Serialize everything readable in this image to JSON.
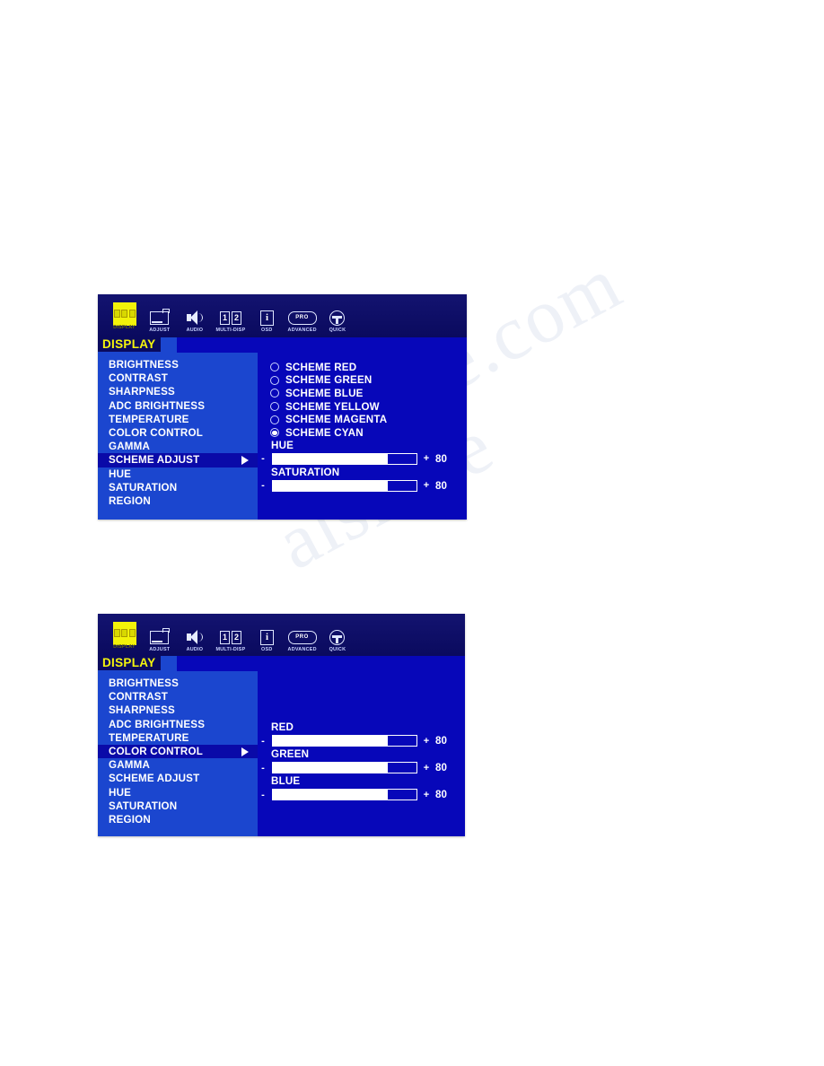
{
  "page": {
    "watermark_lines": [
      "e.com",
      "alsnive"
    ]
  },
  "osd_panels": [
    {
      "id": "scheme-adjust",
      "toolbar": {
        "items": [
          {
            "label": "DISPLAY",
            "icon": "display-icon",
            "active": true
          },
          {
            "label": "ADJUST",
            "icon": "monitor-icon",
            "active": false
          },
          {
            "label": "AUDIO",
            "icon": "speaker-icon",
            "active": false
          },
          {
            "label": "MULTI-DISP",
            "icon": "multi-display-icon",
            "active": false,
            "box1": "1",
            "box2": "2"
          },
          {
            "label": "OSD",
            "icon": "info-icon",
            "active": false,
            "glyph": "i"
          },
          {
            "label": "ADVANCED",
            "icon": "pro-badge-icon",
            "active": false,
            "glyph": "PRO"
          },
          {
            "label": "QUICK",
            "icon": "quick-icon",
            "active": false
          }
        ]
      },
      "active_tab_label": "DISPLAY",
      "menu": [
        {
          "label": "BRIGHTNESS",
          "selected": false
        },
        {
          "label": "CONTRAST",
          "selected": false
        },
        {
          "label": "SHARPNESS",
          "selected": false
        },
        {
          "label": "ADC BRIGHTNESS",
          "selected": false
        },
        {
          "label": "TEMPERATURE",
          "selected": false
        },
        {
          "label": "COLOR CONTROL",
          "selected": false
        },
        {
          "label": "GAMMA",
          "selected": false
        },
        {
          "label": "SCHEME ADJUST",
          "selected": true
        },
        {
          "label": "HUE",
          "selected": false
        },
        {
          "label": "SATURATION",
          "selected": false
        },
        {
          "label": "REGION",
          "selected": false
        }
      ],
      "radio_options": [
        {
          "label": "SCHEME RED",
          "checked": false
        },
        {
          "label": "SCHEME GREEN",
          "checked": false
        },
        {
          "label": "SCHEME BLUE",
          "checked": false
        },
        {
          "label": "SCHEME YELLOW",
          "checked": false
        },
        {
          "label": "SCHEME MAGENTA",
          "checked": false
        },
        {
          "label": "SCHEME CYAN",
          "checked": true
        }
      ],
      "sliders": [
        {
          "label": "HUE",
          "minus": "-",
          "plus": "+",
          "value": "80",
          "percent": 80
        },
        {
          "label": "SATURATION",
          "minus": "-",
          "plus": "+",
          "value": "80",
          "percent": 80
        }
      ]
    },
    {
      "id": "color-control",
      "toolbar": {
        "items": [
          {
            "label": "DISPLAY",
            "icon": "display-icon",
            "active": true
          },
          {
            "label": "ADJUST",
            "icon": "monitor-icon",
            "active": false
          },
          {
            "label": "AUDIO",
            "icon": "speaker-icon",
            "active": false
          },
          {
            "label": "MULTI-DISP",
            "icon": "multi-display-icon",
            "active": false,
            "box1": "1",
            "box2": "2"
          },
          {
            "label": "OSD",
            "icon": "info-icon",
            "active": false,
            "glyph": "i"
          },
          {
            "label": "ADVANCED",
            "icon": "pro-badge-icon",
            "active": false,
            "glyph": "PRO"
          },
          {
            "label": "QUICK",
            "icon": "quick-icon",
            "active": false
          }
        ]
      },
      "active_tab_label": "DISPLAY",
      "menu": [
        {
          "label": "BRIGHTNESS",
          "selected": false
        },
        {
          "label": "CONTRAST",
          "selected": false
        },
        {
          "label": "SHARPNESS",
          "selected": false
        },
        {
          "label": "ADC BRIGHTNESS",
          "selected": false
        },
        {
          "label": "TEMPERATURE",
          "selected": false
        },
        {
          "label": "COLOR CONTROL",
          "selected": true
        },
        {
          "label": "GAMMA",
          "selected": false
        },
        {
          "label": "SCHEME ADJUST",
          "selected": false
        },
        {
          "label": "HUE",
          "selected": false
        },
        {
          "label": "SATURATION",
          "selected": false
        },
        {
          "label": "REGION",
          "selected": false
        }
      ],
      "radio_options": [],
      "sliders": [
        {
          "label": "RED",
          "minus": "-",
          "plus": "+",
          "value": "80",
          "percent": 80
        },
        {
          "label": "GREEN",
          "minus": "-",
          "plus": "+",
          "value": "80",
          "percent": 80
        },
        {
          "label": "BLUE",
          "minus": "-",
          "plus": "+",
          "value": "80",
          "percent": 80
        }
      ]
    }
  ]
}
